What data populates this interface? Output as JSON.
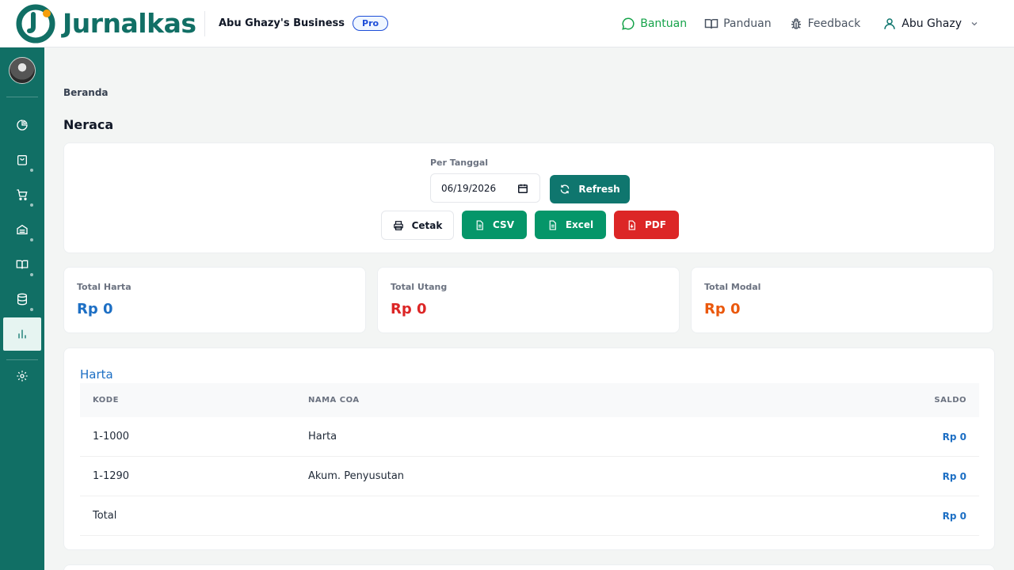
{
  "app": {
    "logo_text": "Jurnalkas",
    "business_name": "Abu Ghazy's Business",
    "plan_badge": "Pro"
  },
  "topnav": {
    "help": "Bantuan",
    "guide": "Panduan",
    "feedback": "Feedback",
    "user": "Abu Ghazy"
  },
  "sidebar": {
    "items": [
      {
        "icon": "pie-chart-icon"
      },
      {
        "icon": "shopping-bag-icon"
      },
      {
        "icon": "shopping-cart-icon"
      },
      {
        "icon": "archive-icon"
      },
      {
        "icon": "book-icon"
      },
      {
        "icon": "database-icon"
      },
      {
        "icon": "bar-chart-icon",
        "active": true
      },
      {
        "icon": "gear-icon"
      }
    ]
  },
  "page": {
    "breadcrumb": "Beranda",
    "title": "Neraca"
  },
  "filter": {
    "date_label": "Per Tanggal",
    "date_value": "06/19/2026",
    "refresh": "Refresh",
    "print": "Cetak",
    "csv": "CSV",
    "excel": "Excel",
    "pdf": "PDF"
  },
  "stats": [
    {
      "label": "Total Harta",
      "value": "Rp 0",
      "color": "#1d6fc4"
    },
    {
      "label": "Total Utang",
      "value": "Rp 0",
      "color": "#dc2626"
    },
    {
      "label": "Total Modal",
      "value": "Rp 0",
      "color": "#ea580c"
    }
  ],
  "harta": {
    "title": "Harta",
    "columns": [
      "KODE",
      "NAMA COA",
      "SALDO"
    ],
    "rows": [
      {
        "kode": "1-1000",
        "nama": "Harta",
        "saldo": "Rp 0"
      },
      {
        "kode": "1-1290",
        "nama": "Akum. Penyusutan",
        "saldo": "Rp 0"
      }
    ],
    "total_label": "Total",
    "total_value": "Rp 0"
  },
  "colors": {
    "brand": "#116f65",
    "accent_orange": "#f59e0b"
  }
}
